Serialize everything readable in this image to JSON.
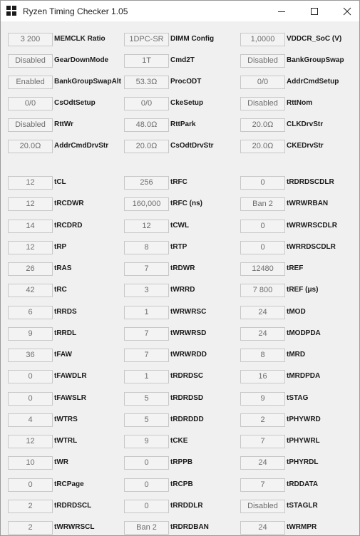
{
  "window": {
    "title": "Ryzen Timing Checker 1.05"
  },
  "rows": [
    [
      {
        "value": "3 200",
        "label": "MEMCLK Ratio"
      },
      {
        "value": "1DPC-SR",
        "label": "DIMM Config"
      },
      {
        "value": "1,0000",
        "label": "VDDCR_SoC (V)"
      }
    ],
    [
      {
        "value": "Disabled",
        "label": "GearDownMode"
      },
      {
        "value": "1T",
        "label": "Cmd2T"
      },
      {
        "value": "Disabled",
        "label": "BankGroupSwap"
      }
    ],
    [
      {
        "value": "Enabled",
        "label": "BankGroupSwapAlt"
      },
      {
        "value": "53.3Ω",
        "label": "ProcODT"
      },
      {
        "value": "0/0",
        "label": "AddrCmdSetup"
      }
    ],
    [
      {
        "value": "0/0",
        "label": "CsOdtSetup"
      },
      {
        "value": "0/0",
        "label": "CkeSetup"
      },
      {
        "value": "Disabled",
        "label": "RttNom"
      }
    ],
    [
      {
        "value": "Disabled",
        "label": "RttWr"
      },
      {
        "value": "48.0Ω",
        "label": "RttPark"
      },
      {
        "value": "20.0Ω",
        "label": "CLKDrvStr"
      }
    ],
    [
      {
        "value": "20.0Ω",
        "label": "AddrCmdDrvStr"
      },
      {
        "value": "20.0Ω",
        "label": "CsOdtDrvStr"
      },
      {
        "value": "20.0Ω",
        "label": "CKEDrvStr"
      }
    ],
    [
      {
        "value": "12",
        "label": "tCL"
      },
      {
        "value": "256",
        "label": "tRFC"
      },
      {
        "value": "0",
        "label": "tRDRDSCDLR"
      }
    ],
    [
      {
        "value": "12",
        "label": "tRCDWR"
      },
      {
        "value": "160,000",
        "label": "tRFC (ns)"
      },
      {
        "value": "Ban 2",
        "label": "tWRWRBAN"
      }
    ],
    [
      {
        "value": "14",
        "label": "tRCDRD"
      },
      {
        "value": "12",
        "label": "tCWL"
      },
      {
        "value": "0",
        "label": "tWRWRSCDLR"
      }
    ],
    [
      {
        "value": "12",
        "label": "tRP"
      },
      {
        "value": "8",
        "label": "tRTP"
      },
      {
        "value": "0",
        "label": "tWRRDSCDLR"
      }
    ],
    [
      {
        "value": "26",
        "label": "tRAS"
      },
      {
        "value": "7",
        "label": "tRDWR"
      },
      {
        "value": "12480",
        "label": "tREF"
      }
    ],
    [
      {
        "value": "42",
        "label": "tRC"
      },
      {
        "value": "3",
        "label": "tWRRD"
      },
      {
        "value": "7 800",
        "label": "tREF (μs)"
      }
    ],
    [
      {
        "value": "6",
        "label": "tRRDS"
      },
      {
        "value": "1",
        "label": "tWRWRSC"
      },
      {
        "value": "24",
        "label": "tMOD"
      }
    ],
    [
      {
        "value": "9",
        "label": "tRRDL"
      },
      {
        "value": "7",
        "label": "tWRWRSD"
      },
      {
        "value": "24",
        "label": "tMODPDA"
      }
    ],
    [
      {
        "value": "36",
        "label": "tFAW"
      },
      {
        "value": "7",
        "label": "tWRWRDD"
      },
      {
        "value": "8",
        "label": "tMRD"
      }
    ],
    [
      {
        "value": "0",
        "label": "tFAWDLR"
      },
      {
        "value": "1",
        "label": "tRDRDSC"
      },
      {
        "value": "16",
        "label": "tMRDPDA"
      }
    ],
    [
      {
        "value": "0",
        "label": "tFAWSLR"
      },
      {
        "value": "5",
        "label": "tRDRDSD"
      },
      {
        "value": "9",
        "label": "tSTAG"
      }
    ],
    [
      {
        "value": "4",
        "label": "tWTRS"
      },
      {
        "value": "5",
        "label": "tRDRDDD"
      },
      {
        "value": "2",
        "label": "tPHYWRD"
      }
    ],
    [
      {
        "value": "12",
        "label": "tWTRL"
      },
      {
        "value": "9",
        "label": "tCKE"
      },
      {
        "value": "7",
        "label": "tPHYWRL"
      }
    ],
    [
      {
        "value": "10",
        "label": "tWR"
      },
      {
        "value": "0",
        "label": "tRPPB"
      },
      {
        "value": "24",
        "label": "tPHYRDL"
      }
    ],
    [
      {
        "value": "0",
        "label": "tRCPage"
      },
      {
        "value": "0",
        "label": "tRCPB"
      },
      {
        "value": "7",
        "label": "tRDDATA"
      }
    ],
    [
      {
        "value": "2",
        "label": "tRDRDSCL"
      },
      {
        "value": "0",
        "label": "tRRDDLR"
      },
      {
        "value": "Disabled",
        "label": "tSTAGLR"
      }
    ],
    [
      {
        "value": "2",
        "label": "tWRWRSCL"
      },
      {
        "value": "Ban 2",
        "label": "tRDRDBAN"
      },
      {
        "value": "24",
        "label": "tWRMPR"
      }
    ]
  ]
}
